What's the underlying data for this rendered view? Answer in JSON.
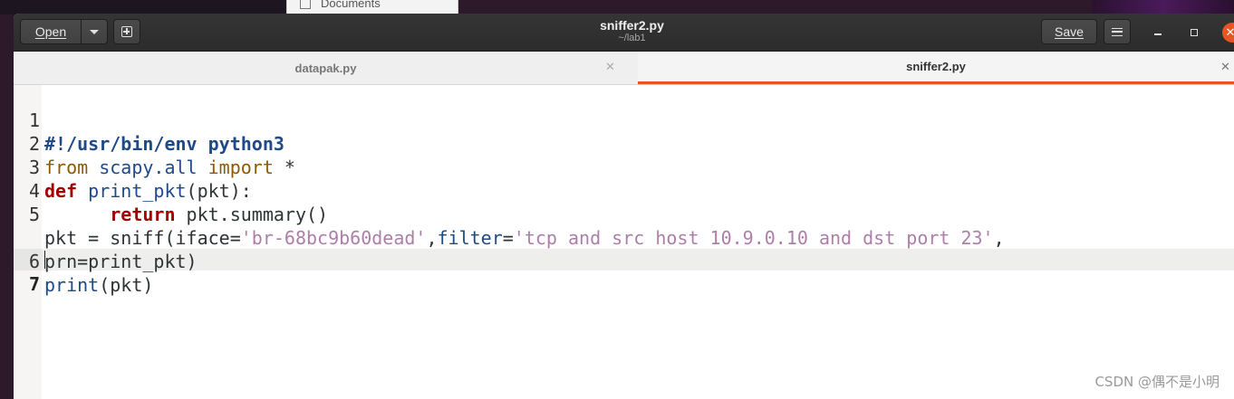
{
  "background_window": {
    "label": "Documents"
  },
  "header": {
    "open_label": "Open",
    "save_label": "Save",
    "title": "sniffer2.py",
    "subtitle": "~/lab1"
  },
  "tabs": [
    {
      "label": "datapak.py",
      "active": false
    },
    {
      "label": "sniffer2.py",
      "active": true
    }
  ],
  "editor": {
    "current_line": 7,
    "lines": [
      {
        "num": "1",
        "shebang": "#!/usr/bin/env python3"
      },
      {
        "num": "2",
        "from": "from",
        "module": " scapy.all ",
        "import": "import",
        "rest": " *"
      },
      {
        "num": "3",
        "def": "def",
        "fname": " print_pkt",
        "rest": "(pkt):"
      },
      {
        "num": "4",
        "indent": "      ",
        "ret": "return",
        "rest": " pkt.summary()"
      },
      {
        "num": "5",
        "a": "pkt = sniff(iface=",
        "s1": "'br-68bc9b60dead'",
        "b": ",",
        "kw": "filter",
        "c": "=",
        "s2": "'tcp and src host 10.9.0.10 and dst port 23'",
        "d": ","
      },
      {
        "num": "",
        "cont": "prn=print_pkt)"
      },
      {
        "num": "6",
        "fn": "print",
        "rest": "(pkt)"
      },
      {
        "num": "7"
      }
    ]
  },
  "watermark": "CSDN @偶不是小明",
  "colors": {
    "accent": "#e95420",
    "headerbar": "#2f2f2f"
  }
}
